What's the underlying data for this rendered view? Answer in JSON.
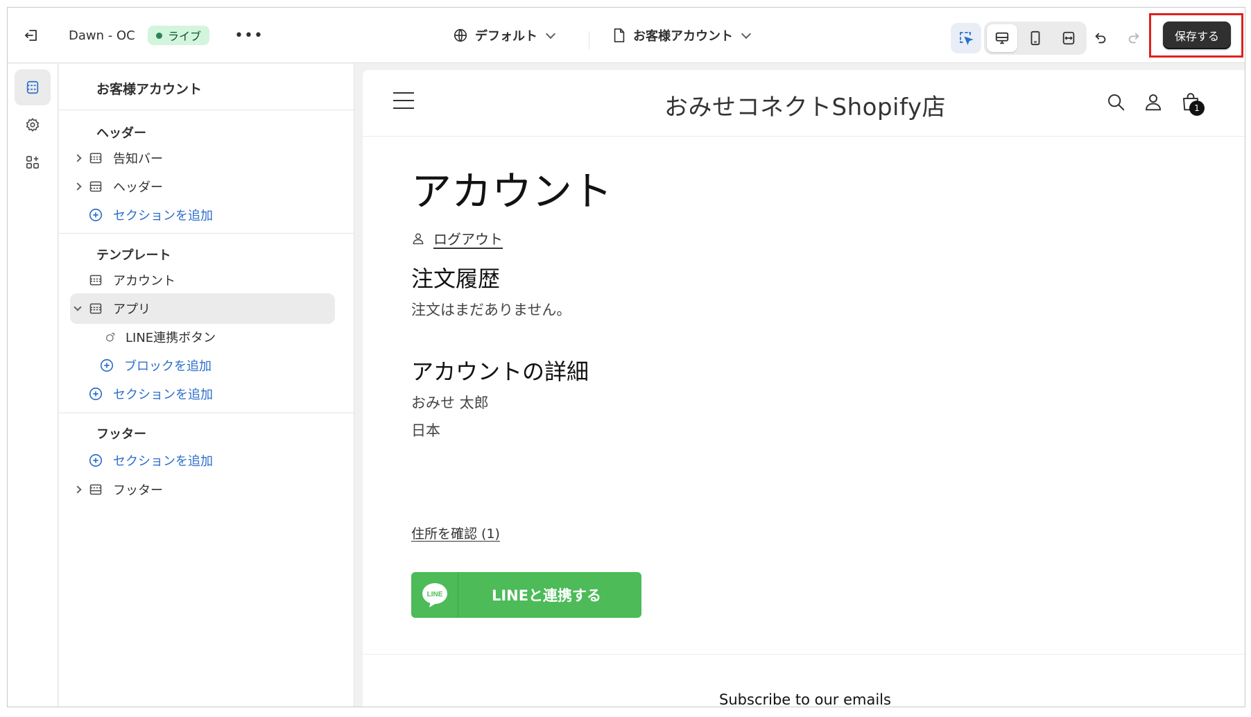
{
  "topbar": {
    "theme_name": "Dawn - OC",
    "live_label": "ライブ",
    "more_label": "•••",
    "locale_label": "デフォルト",
    "page_label": "お客様アカウント",
    "save_label": "保存する"
  },
  "sidebar": {
    "title": "お客様アカウント",
    "header_group": {
      "heading": "ヘッダー",
      "items": [
        {
          "label": "告知バー"
        },
        {
          "label": "ヘッダー"
        }
      ],
      "add_section": "セクションを追加"
    },
    "template_group": {
      "heading": "テンプレート",
      "items": [
        {
          "label": "アカウント"
        },
        {
          "label": "アプリ"
        }
      ],
      "app_block": "LINE連携ボタン",
      "add_block": "ブロックを追加",
      "add_section": "セクションを追加"
    },
    "footer_group": {
      "heading": "フッター",
      "add_section": "セクションを追加",
      "items": [
        {
          "label": "フッター"
        }
      ]
    }
  },
  "preview": {
    "store_name": "おみせコネクトShopify店",
    "cart_count": "1",
    "account_title": "アカウント",
    "logout": "ログアウト",
    "orders_title": "注文履歴",
    "orders_empty": "注文はまだありません。",
    "details_title": "アカウントの詳細",
    "customer_name": "おみせ 太郎",
    "customer_country": "日本",
    "address_link": "住所を確認 (1)",
    "line_logo_text": "LINE",
    "line_button": "LINEと連携する",
    "subscribe": "Subscribe to our emails"
  },
  "colors": {
    "accent_blue": "#2c6ecb",
    "live_green": "#29845a",
    "line_green": "#4cbb58",
    "save_dark": "#303030",
    "highlight_red": "#e02020"
  }
}
